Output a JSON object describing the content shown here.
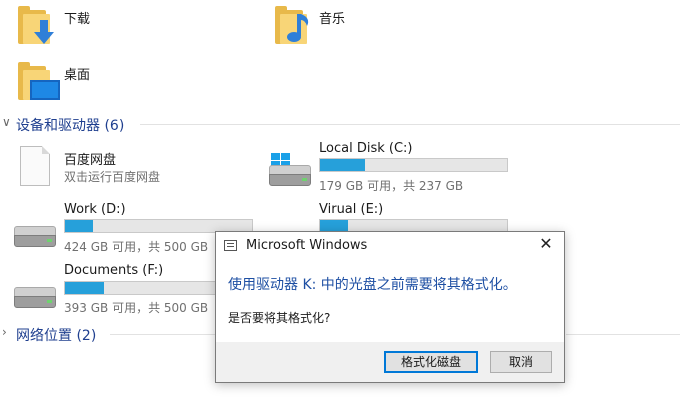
{
  "folders": [
    {
      "label": "下载"
    },
    {
      "label": "音乐"
    },
    {
      "label": "桌面"
    }
  ],
  "devices": {
    "header": "设备和驱动器 (6)",
    "items": [
      {
        "name": "百度网盘",
        "sub": "双击运行百度网盘"
      },
      {
        "name": "Local Disk (C:)",
        "sub": "179 GB 可用，共 237 GB",
        "used_fraction": 0.24
      },
      {
        "name": "Work (D:)",
        "sub": "424 GB 可用，共 500 GB",
        "used_fraction": 0.15
      },
      {
        "name": "Virual (E:)",
        "used_fraction": 0.15
      },
      {
        "name": "Documents (F:)",
        "sub": "393 GB 可用，共 500 GB",
        "used_fraction": 0.21
      }
    ]
  },
  "network": {
    "header": "网络位置 (2)"
  },
  "dialog": {
    "title": "Microsoft Windows",
    "close": "✕",
    "message": "使用驱动器 K: 中的光盘之前需要将其格式化。",
    "question": "是否要将其格式化?",
    "format_button": "格式化磁盘",
    "cancel_button": "取消"
  },
  "colors": {
    "progress": "#26a0da",
    "link": "#1e4fa3"
  }
}
